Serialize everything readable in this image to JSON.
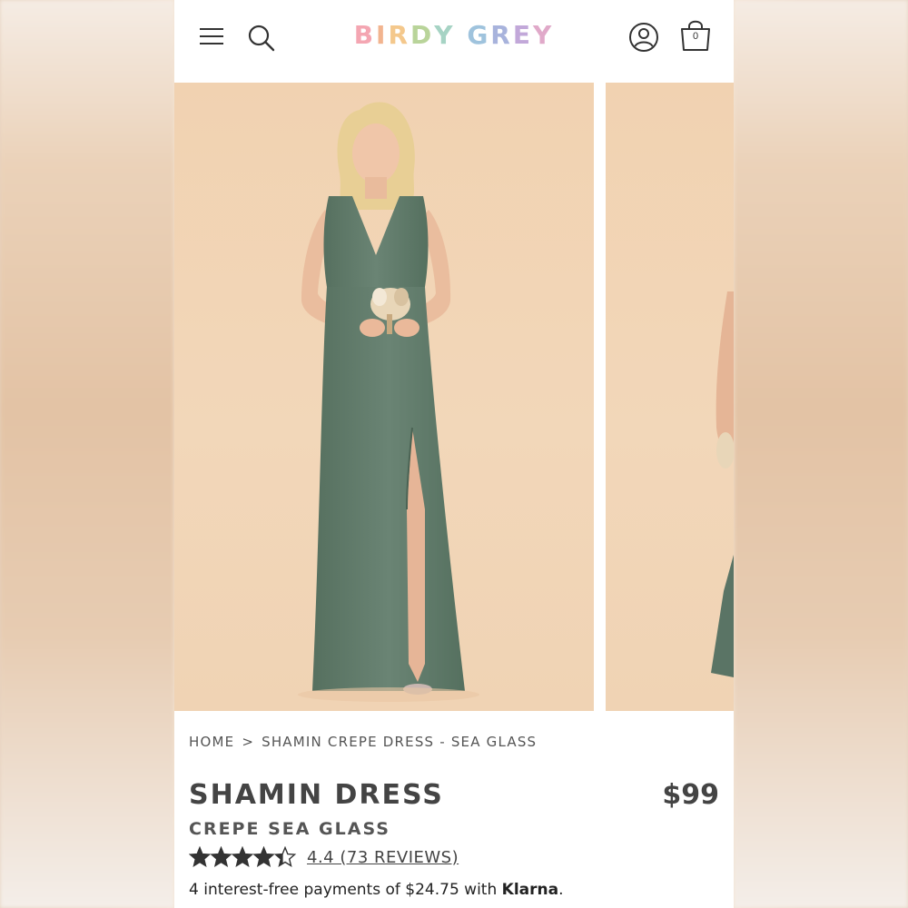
{
  "header": {
    "logo_letters": [
      {
        "ch": "B",
        "color": "#f4a6b2"
      },
      {
        "ch": "I",
        "color": "#f2b48f"
      },
      {
        "ch": "R",
        "color": "#f4c88c"
      },
      {
        "ch": "D",
        "color": "#b9d49a"
      },
      {
        "ch": "Y",
        "color": "#a6d3c4"
      },
      {
        "ch": " ",
        "color": "#ffffff"
      },
      {
        "ch": "G",
        "color": "#9fc3dd"
      },
      {
        "ch": "R",
        "color": "#a8b3dc"
      },
      {
        "ch": "E",
        "color": "#c2a8d9"
      },
      {
        "ch": "Y",
        "color": "#e0a9c9"
      }
    ],
    "cart_count": "0",
    "icons": {
      "menu": "hamburger-menu-icon",
      "search": "search-icon",
      "account": "user-account-icon",
      "cart": "shopping-bag-icon"
    }
  },
  "gallery": {
    "dress_color": "#5f7a6c",
    "backdrop_color": "#f1d4b5"
  },
  "breadcrumb": {
    "home": "HOME",
    "separator": ">",
    "current": "SHAMIN CREPE DRESS - SEA GLASS"
  },
  "product": {
    "title": "SHAMIN DRESS",
    "subtitle": "CREPE SEA GLASS",
    "price": "$99",
    "rating_value": 4.4,
    "rating_max": 5,
    "rating_text": "4.4 (73 REVIEWS)"
  },
  "payments": {
    "text": "4 interest-free payments of $24.75 with ",
    "provider": "Klarna",
    "suffix": "."
  },
  "colors": {
    "text_dark": "#444444",
    "star_color": "#333333"
  }
}
